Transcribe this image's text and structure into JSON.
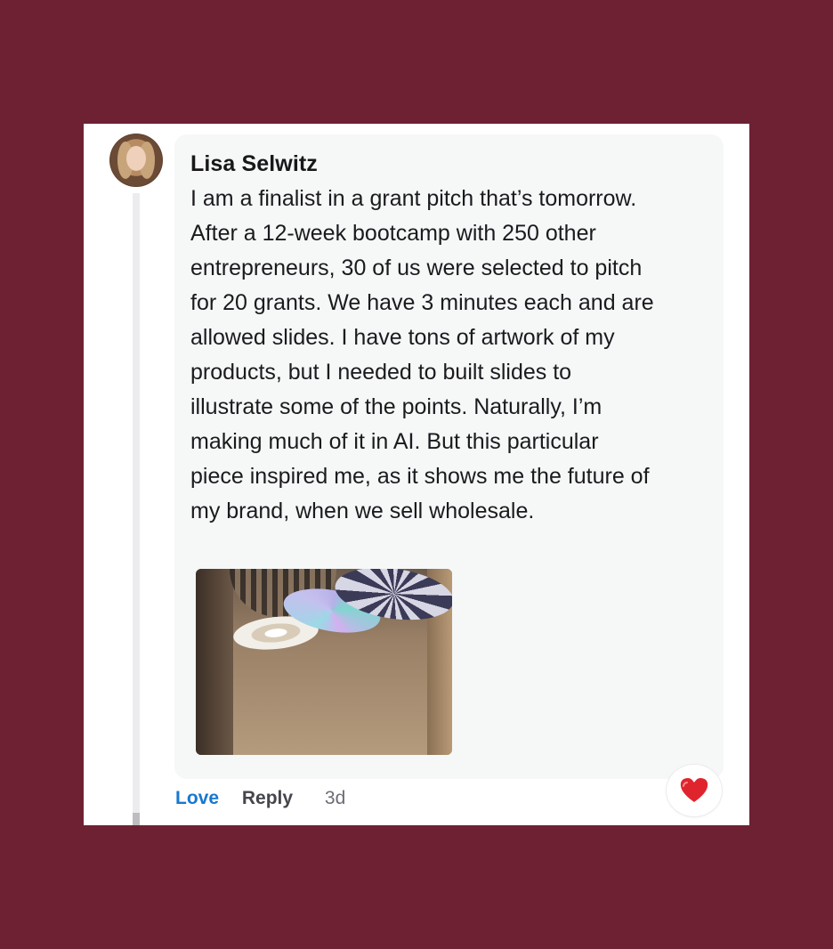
{
  "comment": {
    "author": "Lisa Selwitz",
    "text": "I am a finalist in a grant pitch that’s tomorrow.\nAfter a 12-week bootcamp with 250 other\nentrepreneurs, 30 of us were selected to pitch\nfor 20 grants. We have 3 minutes each and are\nallowed slides. I have tons of artwork of my\nproducts, but I needed to built slides to\nillustrate some of the points. Naturally, I’m\nmaking much of it in AI. But this particular\npiece inspired me, as it shows me the future of\nmy brand, when we sell wholesale.",
    "photo_alt": "mannequins in a boutique window with decorative umbrellas",
    "actions": {
      "love": "Love",
      "reply": "Reply",
      "time": "3d"
    },
    "reaction": {
      "icon": "heart-icon",
      "color": "#e0242e"
    }
  },
  "theme": {
    "background": "#6f2134",
    "card": "#ffffff",
    "bubble": "#f6f7f7",
    "link": "#1778d1"
  }
}
